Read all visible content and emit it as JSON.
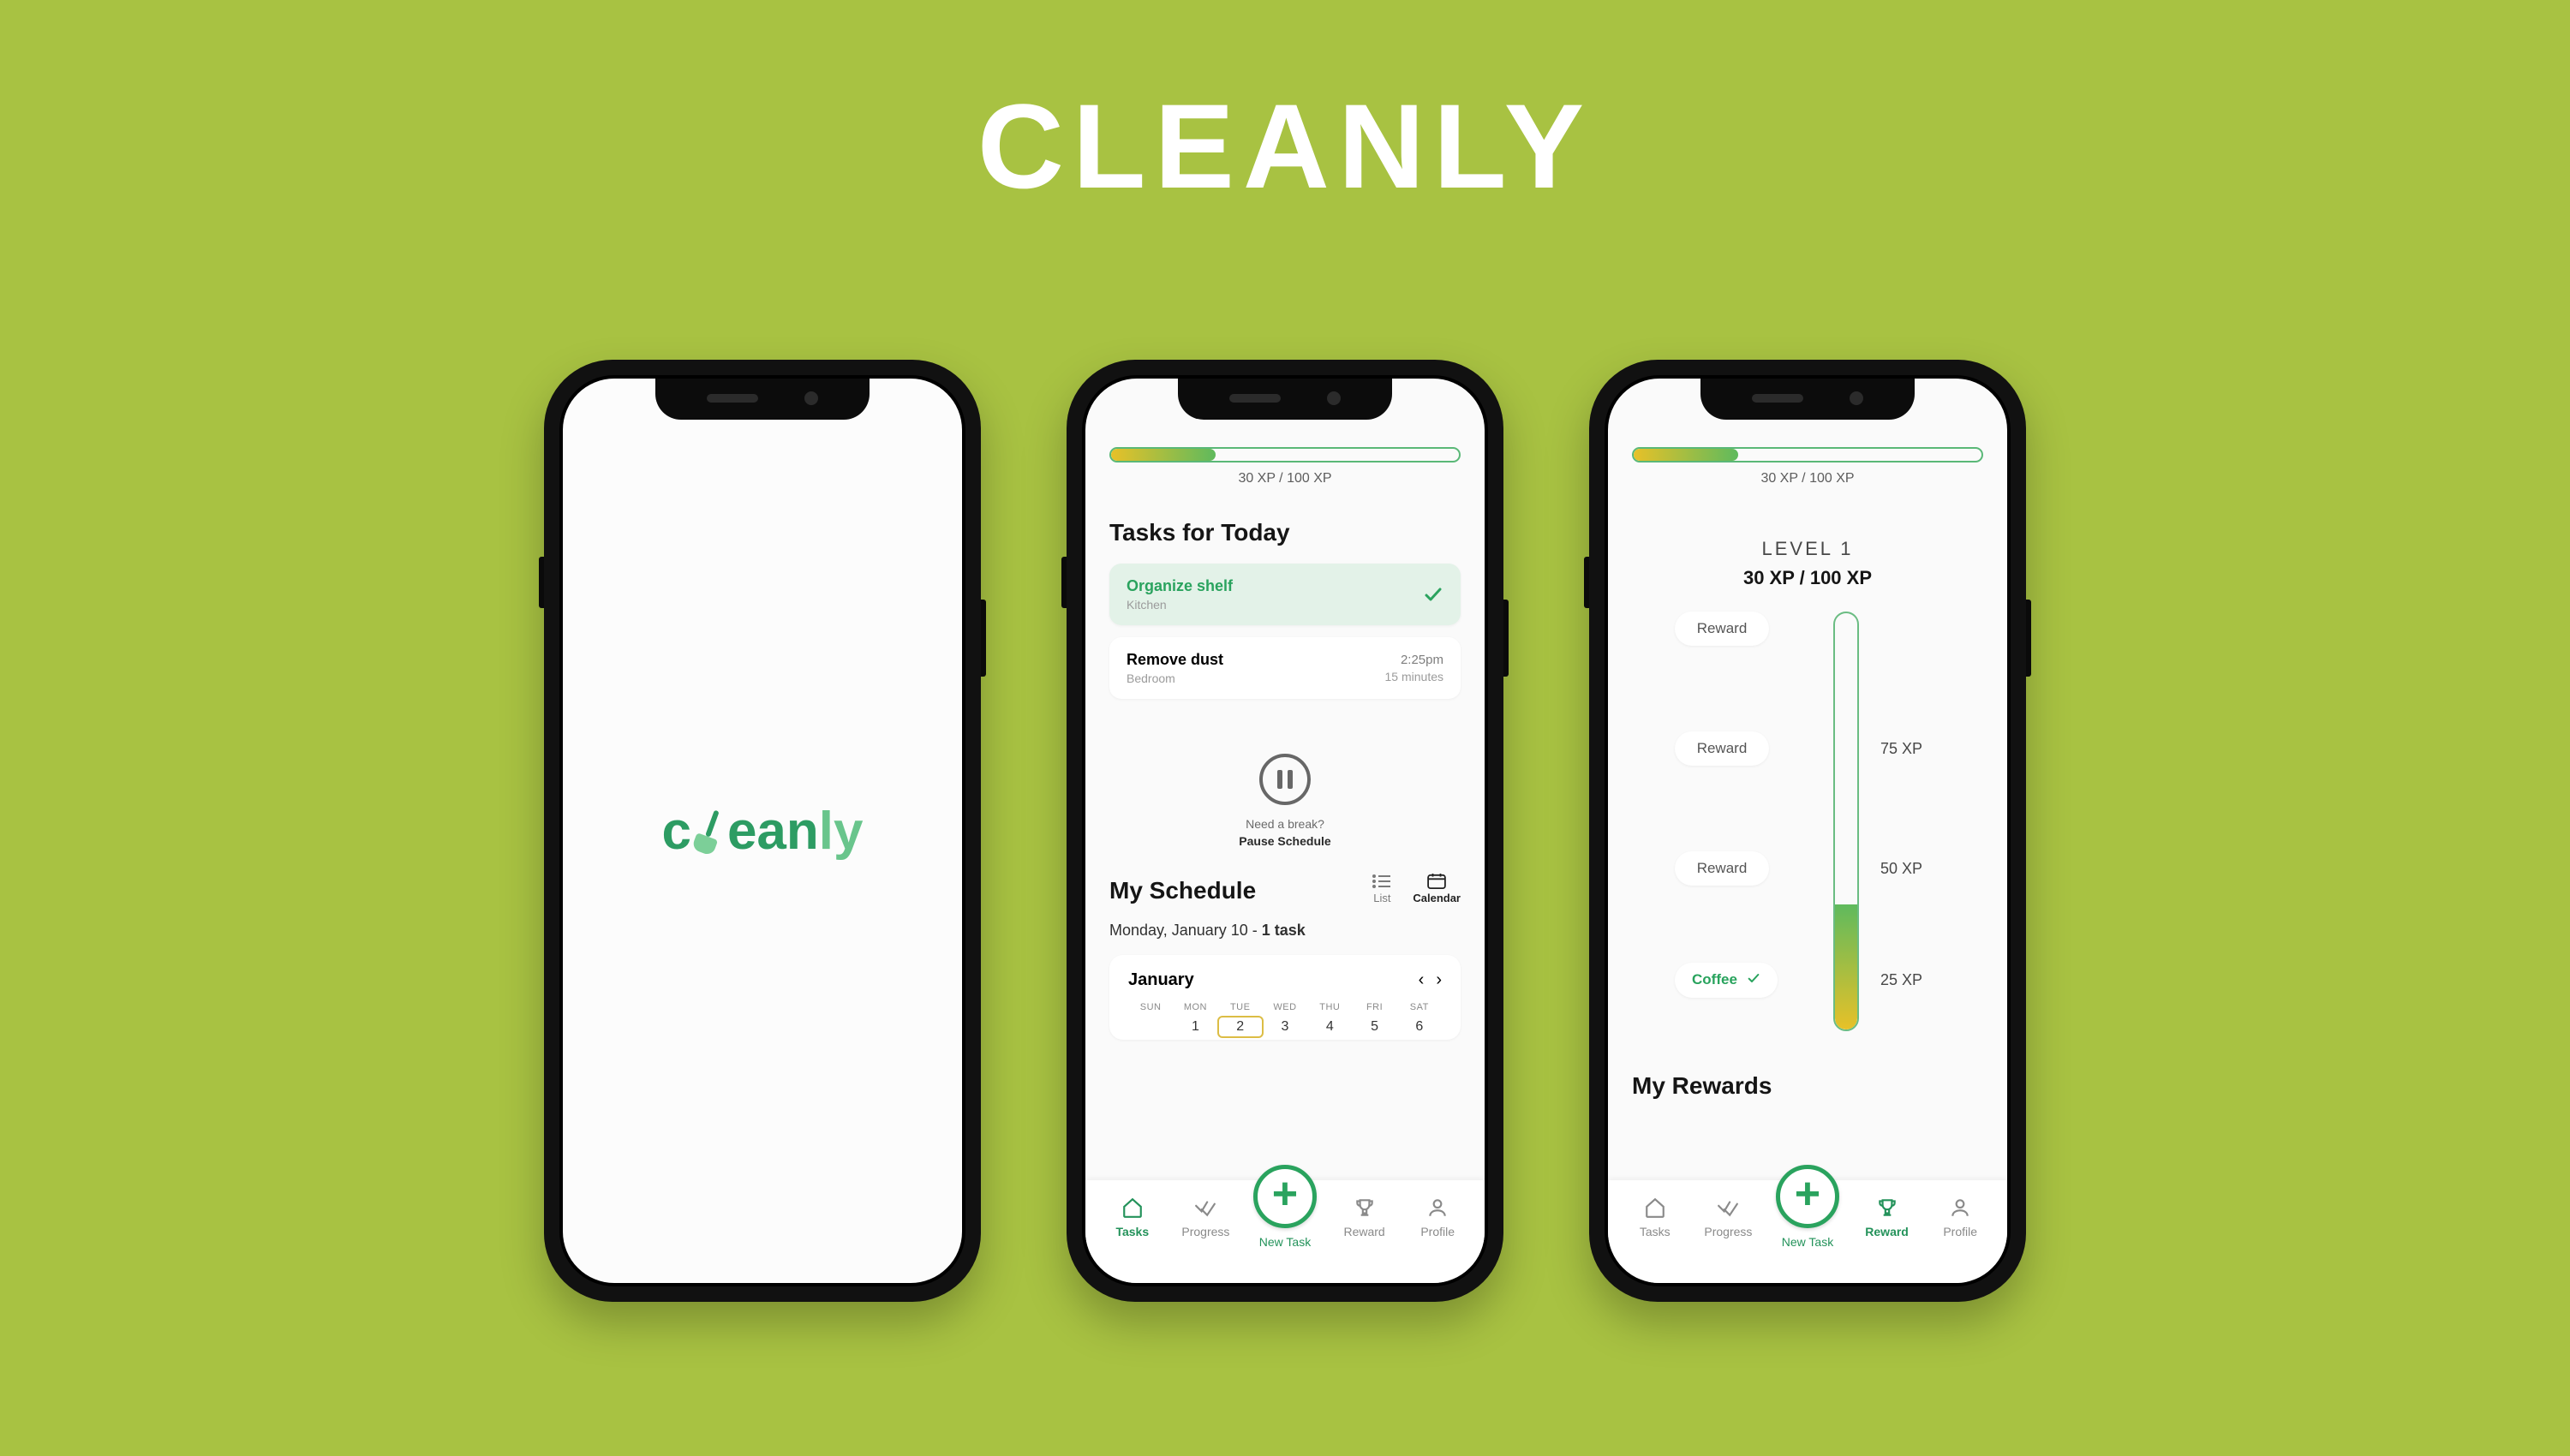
{
  "hero_title": "CLEANLY",
  "logo_text": "cleanly",
  "xp": {
    "label": "30 XP / 100 XP",
    "current": 30,
    "max": 100
  },
  "tasks": {
    "title": "Tasks for Today",
    "items": [
      {
        "title": "Organize shelf",
        "location": "Kitchen",
        "time": "",
        "duration": "",
        "done": true
      },
      {
        "title": "Remove dust",
        "location": "Bedroom",
        "time": "2:25pm",
        "duration": "15 minutes",
        "done": false
      }
    ]
  },
  "pause": {
    "question": "Need a break?",
    "action": "Pause Schedule"
  },
  "schedule": {
    "title": "My Schedule",
    "views": {
      "list": "List",
      "calendar": "Calendar"
    },
    "day_line_prefix": "Monday, January 10 - ",
    "day_line_strong": "1 task",
    "month": "January",
    "dow": [
      "SUN",
      "MON",
      "TUE",
      "WED",
      "THU",
      "FRI",
      "SAT"
    ],
    "days": [
      "",
      "1",
      "2",
      "3",
      "4",
      "5",
      "6"
    ],
    "today_index": 2
  },
  "rewards": {
    "level_label": "LEVEL 1",
    "level_xp": "30 XP / 100 XP",
    "rungs": [
      {
        "label": "Reward",
        "xp": "",
        "done": false
      },
      {
        "label": "Reward",
        "xp": "75 XP",
        "done": false
      },
      {
        "label": "Reward",
        "xp": "50 XP",
        "done": false
      },
      {
        "label": "Coffee",
        "xp": "25 XP",
        "done": true
      }
    ],
    "section_title": "My Rewards"
  },
  "nav": {
    "tasks": "Tasks",
    "progress": "Progress",
    "new_task": "New Task",
    "reward": "Reward",
    "profile": "Profile"
  }
}
